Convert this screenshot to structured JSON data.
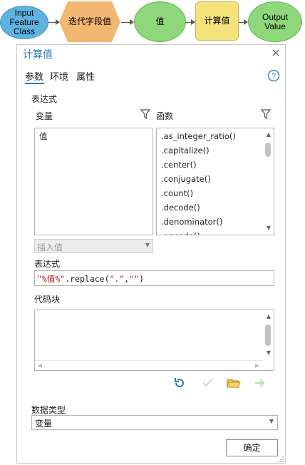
{
  "model": {
    "nodes": [
      {
        "label": "Input\nFeature\nClass",
        "type": "ellipse-blue"
      },
      {
        "label": "迭代字段值",
        "type": "hexagon"
      },
      {
        "label": "值",
        "type": "ellipse-green"
      },
      {
        "label": "计算值",
        "type": "rect-yellow"
      },
      {
        "label": "Output\nValue",
        "type": "ellipse-green"
      }
    ]
  },
  "dialog": {
    "title": "计算值",
    "close_icon": "close-icon",
    "tabs": [
      "参数",
      "环境",
      "属性"
    ],
    "active_tab": "参数",
    "help_icon": "help-icon",
    "expression_section": "表达式",
    "variables_header": "变量",
    "functions_header": "函数",
    "variables": [
      "值"
    ],
    "functions": [
      ".as_integer_ratio()",
      ".capitalize()",
      ".center()",
      ".conjugate()",
      ".count()",
      ".decode()",
      ".denominator()",
      ".encode()"
    ],
    "insert_value": "插入值",
    "expression_label": "表达式",
    "expression_value": {
      "p1": "\"%值%\"",
      "p2": ".replace(",
      "p3": "\".\"",
      "p4": ",",
      "p5": "\"\"",
      "p6": ")"
    },
    "codeblock_label": "代码块",
    "toolbar_icons": [
      "undo-icon",
      "check-icon",
      "open-folder-icon",
      "run-arrow-icon"
    ],
    "data_type_label": "数据类型",
    "data_type_value": "变量",
    "ok_button": "确定",
    "colors": {
      "accent": "#2b7bb9",
      "string": "#a31515"
    }
  }
}
